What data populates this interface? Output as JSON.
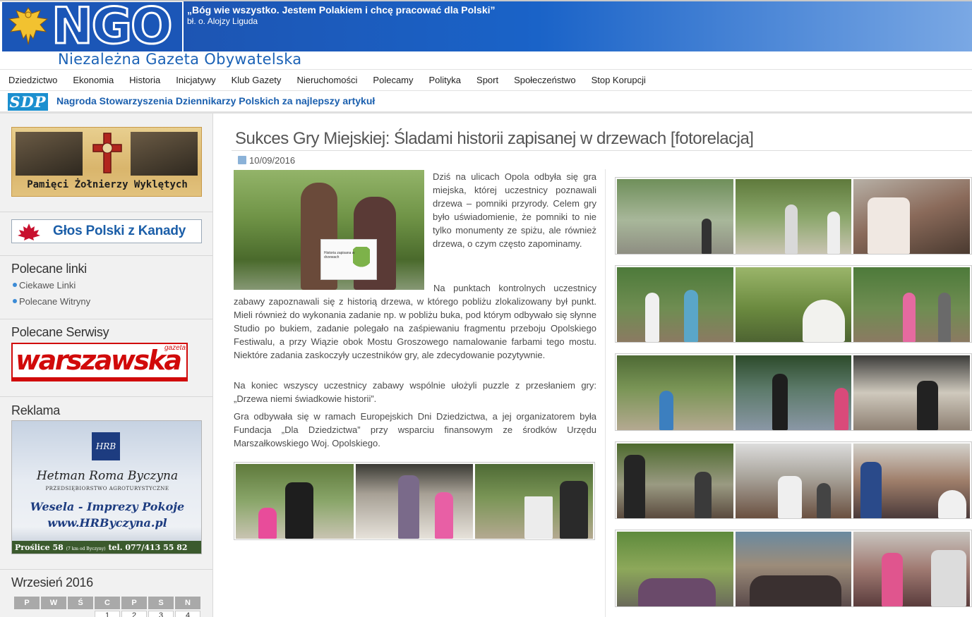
{
  "header": {
    "logo_text": "NGO",
    "motto": "„Bóg wie wszystko. Jestem Polakiem i chcę pracować dla Polski”",
    "motto_author": "bł. o. Alojzy Liguda",
    "subtitle": "Niezależna Gazeta Obywatelska"
  },
  "nav": {
    "items": [
      "Dziedzictwo",
      "Ekonomia",
      "Historia",
      "Inicjatywy",
      "Klub Gazety",
      "Nieruchomości",
      "Polecamy",
      "Polityka",
      "Sport",
      "Społeczeństwo",
      "Stop Korupcji"
    ]
  },
  "award": {
    "logo": "SDP",
    "text": "Nagroda Stowarzyszenia Dziennikarzy Polskich za najlepszy artykuł"
  },
  "sidebar": {
    "banner1_text": "Pamięci Żołnierzy Wyklętych",
    "banner2_text": "Głos Polski z Kanady",
    "links_title": "Polecane linki",
    "links": [
      "Ciekawe Linki",
      "Polecane Witryny"
    ],
    "services_title": "Polecane Serwisy",
    "services_logo": "warszawska",
    "services_logo_small": "gazeta",
    "ad_title": "Reklama",
    "ad": {
      "logo": "HRB",
      "name": "Hetman Roma Byczyna",
      "sub": "PRZEDSIĘBIORSTWO AGROTURYSTYCZNE",
      "line1": "Wesela - Imprezy  Pokoje",
      "line2": "www.HRByczyna.pl",
      "footer_left": "Proślice 58",
      "footer_small": "(7 km od Byczyny)",
      "footer_right": "tel. 077/413 55 82"
    },
    "calendar_title": "Wrzesień 2016",
    "calendar_days": [
      "P",
      "W",
      "Ś",
      "C",
      "P",
      "S",
      "N"
    ],
    "calendar_first_row": [
      "",
      "",
      "",
      "1",
      "2",
      "3",
      "4"
    ]
  },
  "article": {
    "title": "Sukces Gry Miejskiej: Śladami historii zapisanej w drzewach [fotorelacja]",
    "date": "10/09/2016",
    "para1_right": "Dziś na ulicach Opola odbyła się gra miejska, której uczestnicy poznawali drzewa – pomniki przyrody. Celem gry było uświadomienie, że pomniki to nie tylko monumenty ze spiżu, ale również drzewa, o czym często zapominamy.",
    "para1_full": "Na punktach kontrolnych uczestnicy zabawy zapoznawali się z historią drzewa, w którego pobliżu zlokalizowany był punkt. Mieli również do wykonania zadanie np. w pobliżu buka, pod którym odbywało się słynne Studio po bukiem, zadanie polegało na zaśpiewaniu fragmentu przeboju Opolskiego Festiwalu, a przy Wiązie obok Mostu Groszowego namalowanie farbami tego mostu. Niektóre zadania zaskoczyły uczestników gry, ale zdecydowanie pozytywnie.",
    "para2": "Na koniec wszyscy uczestnicy zabawy wspólnie ułożyli puzzle z przesłaniem gry: „Drzewa niemi świadkowie historii”.",
    "para3": "Gra odbywała się w ramach Europejskich Dni Dziedzictwa, a jej organizatorem była Fundacja „Dla Dziedzictwa” przy wsparciu finansowym ze środków Urzędu Marszałkowskiego Woj. Opolskiego.",
    "sign_text": "Historia zapisana w drzewach"
  },
  "colors": {
    "brand_blue": "#1b56b7",
    "link_blue": "#1a5fae",
    "ad_red": "#d10a0a"
  }
}
